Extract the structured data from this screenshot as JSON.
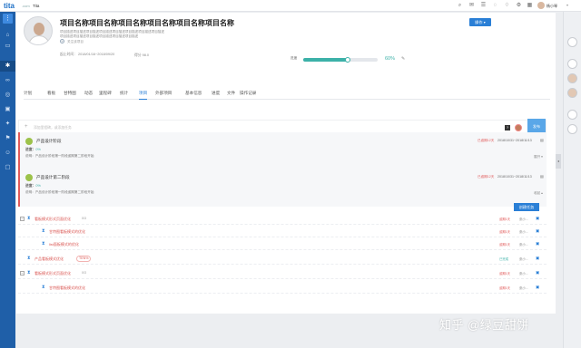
{
  "topbar": {
    "logo": "tita",
    "logo_suffix": ".com",
    "app_name": "Tita",
    "user": "杨小琴",
    "icons": [
      "search-icon",
      "mail-icon",
      "list-icon",
      "chat-icon",
      "bell-icon",
      "settings-icon",
      "apps-icon"
    ]
  },
  "left_nav": {
    "active_index": 4,
    "icons": [
      "menu-icon",
      "home-icon",
      "calendar-icon",
      "chart-icon",
      "grid-icon",
      "link-icon",
      "target-icon",
      "box-icon",
      "gear-icon",
      "flag-icon",
      "user-icon",
      "folder-icon",
      "arrow-icon"
    ]
  },
  "project": {
    "title": "项目名称项目名称项目名称项目名称项目名称项目名称",
    "desc1": "项目描述项目描述项目描述项目描述项目描述项目描述项目描述项目描述",
    "desc2": "项目描述项目描述项目描述项目描述项目描述项目描述",
    "add_label": "关注该项目",
    "action_label": "操作 ▾",
    "date_range": "起止时间：  2018/01/16~2018/09/20",
    "score": "得分 98.0",
    "progress_label": "进度",
    "progress_value": 60,
    "progress_pct": "60%"
  },
  "tabs": {
    "active_index": 6,
    "items": [
      "计划",
      "看板",
      "甘特图",
      "动态",
      "里程碑",
      "统计",
      "项目",
      "外部项目",
      "基本信息",
      "进度",
      "文件",
      "操作记录"
    ]
  },
  "composer": {
    "placeholder": "添加里程碑，或添加任务",
    "q_label": "?",
    "publish_label": "发布"
  },
  "stages": [
    {
      "title": "产品设计阶段",
      "stat_label": "进度：",
      "stat_value": "0%",
      "desc": "说明：产品设计阶段第一阶段逾期第二阶段开始",
      "overdue": "已逾期12天",
      "range": "2018/10/31~2018/11/13",
      "more": "展开 ▾"
    },
    {
      "title": "产品设计第二阶段",
      "stat_label": "进度：",
      "stat_value": "0%",
      "desc": "说明：产品设计阶段第一阶段逾期第二阶段开始",
      "overdue": "已逾期12天",
      "range": "2018/10/31~2018/11/13",
      "more": "收起 ▴"
    }
  ],
  "new_task_label": "创建任务",
  "tasks": [
    {
      "level": 0,
      "toggle": "−",
      "name": "看板模式形式页面优化",
      "name_color": "red",
      "count": "0/3",
      "badge": "",
      "date": "逾期1天",
      "date_color": "red",
      "user": "张小..."
    },
    {
      "level": 1,
      "toggle": "",
      "name": "甘特图看板模式的优化",
      "name_color": "red",
      "count": "",
      "badge": "",
      "date": "逾期1天",
      "date_color": "red",
      "user": "张小..."
    },
    {
      "level": 1,
      "toggle": "",
      "name": "list面板模式的优化",
      "name_color": "red",
      "count": "",
      "badge": "",
      "date": "逾期1天",
      "date_color": "red",
      "user": "张小..."
    },
    {
      "level": 0,
      "toggle": "",
      "name": "产品看板模式优化",
      "name_color": "red",
      "count": "",
      "badge": "TEN%",
      "date": "已完成",
      "date_color": "green",
      "user": "张小..."
    },
    {
      "level": 0,
      "toggle": "−",
      "name": "看板模式形式页面优化",
      "name_color": "red",
      "count": "0/3",
      "badge": "",
      "date": "逾期1天",
      "date_color": "red",
      "user": "张小..."
    },
    {
      "level": 1,
      "toggle": "",
      "name": "甘特图看板模式的优化",
      "name_color": "red",
      "count": "",
      "badge": "",
      "date": "逾期1天",
      "date_color": "red",
      "user": "张小..."
    }
  ],
  "watermark": "知乎 @绿豆甜饼"
}
